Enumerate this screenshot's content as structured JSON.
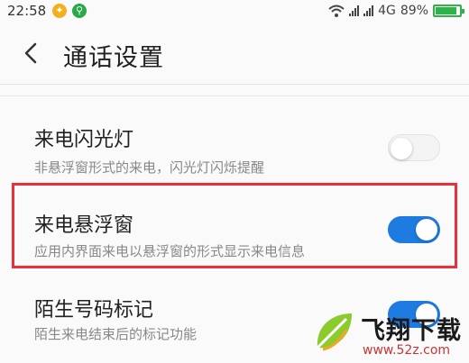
{
  "status_bar": {
    "time": "22:58",
    "network_type": "4G",
    "battery_text": "89%",
    "battery_level": 0.89,
    "icons": [
      "app-notification-icon",
      "usb-icon",
      "wifi-icon",
      "signal-icon",
      "battery-icon"
    ]
  },
  "header": {
    "title": "通话设置",
    "back_icon": "chevron-left-icon"
  },
  "settings": [
    {
      "title": "来电闪光灯",
      "subtitle": "非悬浮窗形式的来电，闪光灯闪烁提醒",
      "enabled": false
    },
    {
      "title": "来电悬浮窗",
      "subtitle": "应用内界面来电以悬浮窗的形式显示来电信息",
      "enabled": true
    },
    {
      "title": "陌生号码标记",
      "subtitle": "陌生来电结束后的标记功能",
      "enabled": true
    }
  ],
  "watermark": {
    "name": "飞翔下载",
    "url": "www.52z.com"
  },
  "colors": {
    "toggle_on": "#1e7be0",
    "toggle_off": "#f4f4f4",
    "highlight": "#e8303a",
    "battery": "#2fb24a"
  }
}
